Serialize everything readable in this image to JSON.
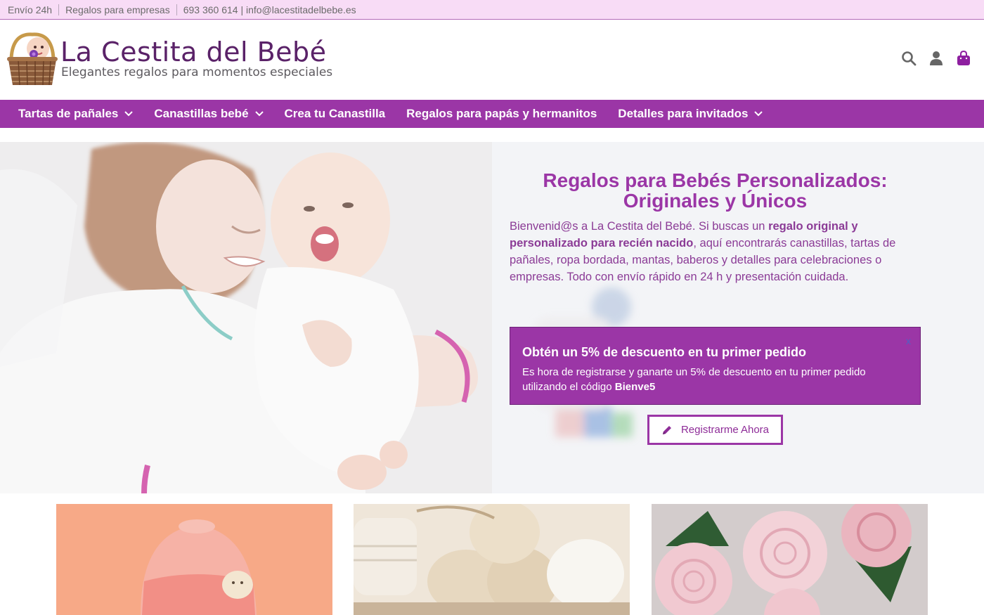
{
  "topbar": {
    "shipping": "Envío 24h",
    "business": "Regalos para empresas",
    "contact": "693 360 614 | info@lacestitadelbebe.es"
  },
  "header": {
    "brand": "La Cestita del Bebé",
    "tagline": "Elegantes regalos para momentos especiales",
    "icons": [
      "search-icon",
      "user-icon",
      "cart-icon"
    ]
  },
  "nav": {
    "items": [
      {
        "label": "Tartas de pañales",
        "dropdown": true
      },
      {
        "label": "Canastillas bebé",
        "dropdown": true
      },
      {
        "label": "Crea tu Canastilla",
        "dropdown": false
      },
      {
        "label": "Regalos para papás y hermanitos",
        "dropdown": false
      },
      {
        "label": "Detalles para invitados",
        "dropdown": true
      }
    ]
  },
  "hero": {
    "title_line1": "Regalos para Bebés Personalizados:",
    "title_line2": "Originales y Únicos",
    "text": {
      "intro": "Bienvenid@s a La Cestita del Bebé. Si buscas un ",
      "bold": "regalo original y personalizado para recién nacido",
      "rest": ", aquí encontrarás canastillas, tartas de pañales, ropa bordada, mantas, baberos y detalles para celebraciones o empresas. Todo con envío rápido en 24 h y presentación cuidada."
    }
  },
  "promo": {
    "title": "Obtén un 5% de descuento en tu primer pedido",
    "text": "Es hora de registrarse y ganarte un 5% de descuento en tu primer pedido utilizando el código ",
    "code": "Bienve5",
    "close": "x"
  },
  "cta": {
    "label": "Registrarme Ahora"
  },
  "colors": {
    "primary": "#9b36a6",
    "topbar_bg": "#f8dcf6",
    "brand_text": "#5a2268",
    "cart_icon": "#8e1fa0"
  }
}
